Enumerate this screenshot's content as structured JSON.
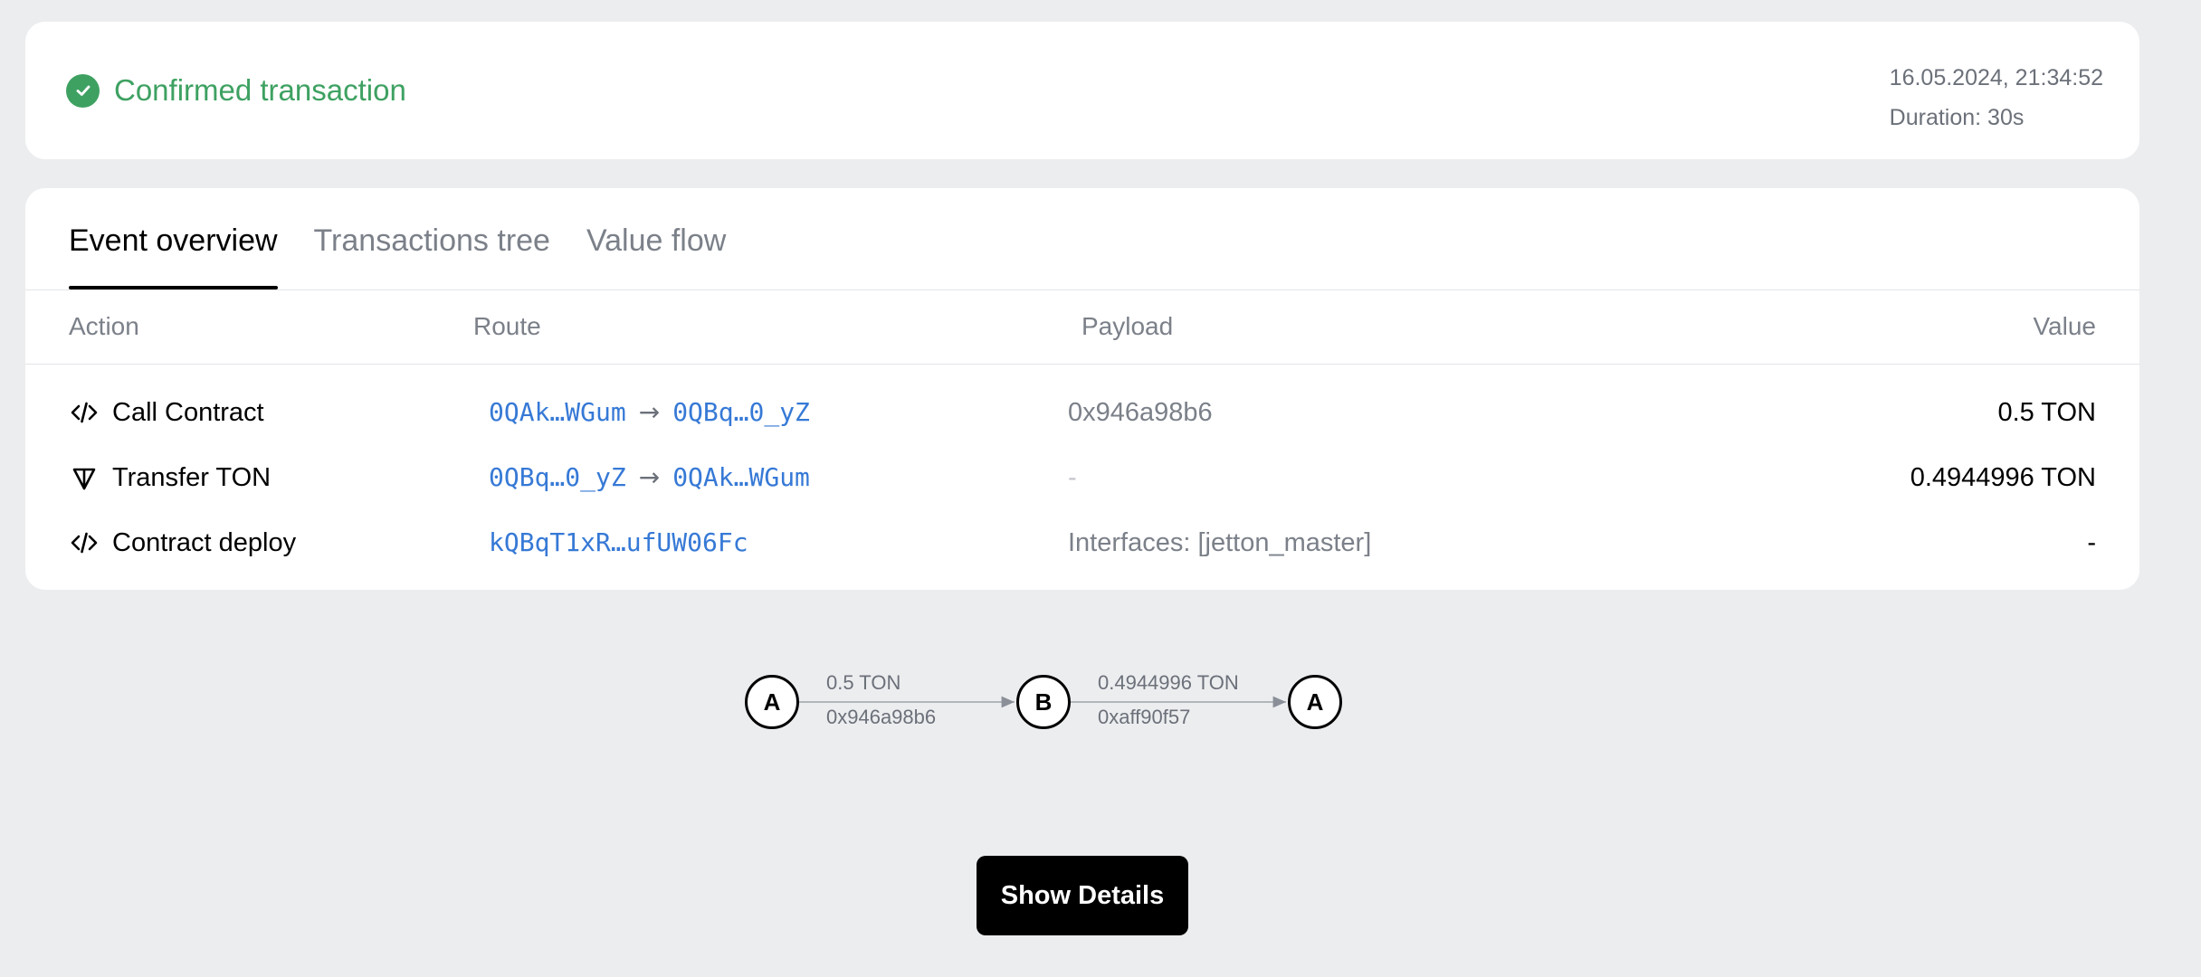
{
  "status": {
    "label": "Confirmed transaction",
    "datetime": "16.05.2024, 21:34:52",
    "duration": "Duration: 30s",
    "color": "#3ea162"
  },
  "tabs": [
    {
      "label": "Event overview",
      "active": true
    },
    {
      "label": "Transactions tree",
      "active": false
    },
    {
      "label": "Value flow",
      "active": false
    }
  ],
  "table": {
    "columns": {
      "action": "Action",
      "route": "Route",
      "payload": "Payload",
      "value": "Value"
    },
    "rows": [
      {
        "icon": "code-icon",
        "action": "Call Contract",
        "from": "0QAk…WGum",
        "arrow": "→",
        "to": "0QBq…0_yZ",
        "payload": "0x946a98b6",
        "value": "0.5 TON"
      },
      {
        "icon": "ton-icon",
        "action": "Transfer TON",
        "from": "0QBq…0_yZ",
        "arrow": "→",
        "to": "0QAk…WGum",
        "payload": "-",
        "value": "0.4944996 TON"
      },
      {
        "icon": "code-icon",
        "action": "Contract deploy",
        "address": "kQBqT1xR…ufUW06Fc",
        "payload": "Interfaces: [jetton_master]",
        "value": "-"
      }
    ]
  },
  "flow": {
    "nodes": [
      "A",
      "B",
      "A"
    ],
    "edges": [
      {
        "amount": "0.5 TON",
        "opcode": "0x946a98b6"
      },
      {
        "amount": "0.4944996 TON",
        "opcode": "0xaff90f57"
      }
    ]
  },
  "button": {
    "label": "Show Details"
  },
  "colors": {
    "link": "#3679d6",
    "muted": "#7b8089",
    "background": "#ecedef"
  }
}
